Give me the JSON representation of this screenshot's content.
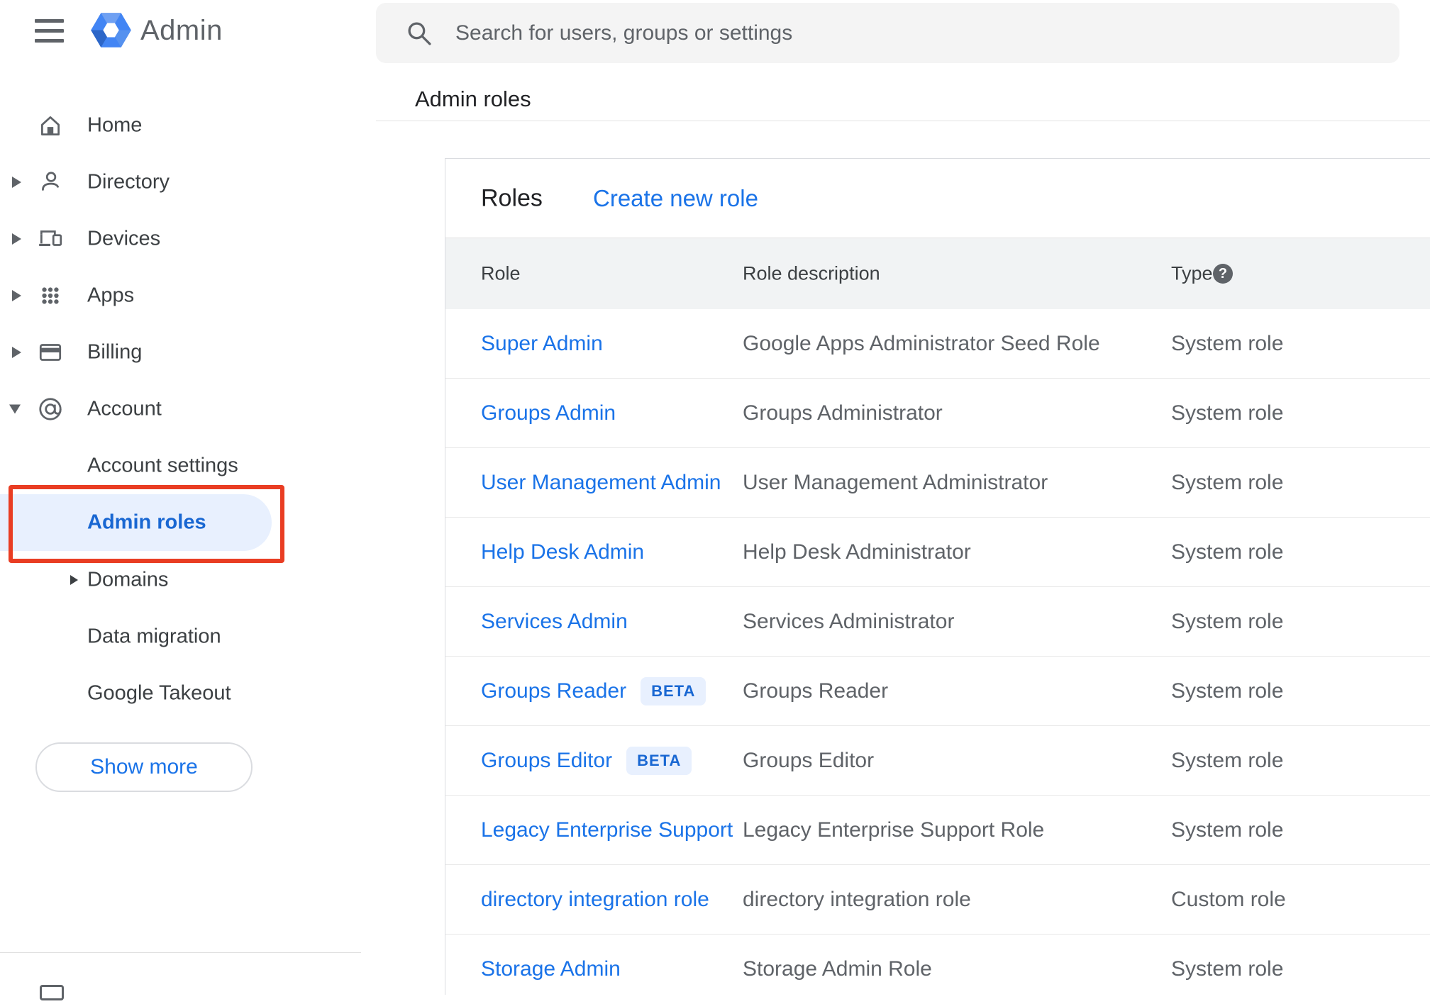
{
  "app_bar": {
    "product_name": "Admin",
    "search_placeholder": "Search for users, groups or settings"
  },
  "sidebar": {
    "items": [
      {
        "label": "Home"
      },
      {
        "label": "Directory"
      },
      {
        "label": "Devices"
      },
      {
        "label": "Apps"
      },
      {
        "label": "Billing"
      },
      {
        "label": "Account"
      },
      {
        "label": "Account settings"
      },
      {
        "label": "Admin roles"
      },
      {
        "label": "Domains"
      },
      {
        "label": "Data migration"
      },
      {
        "label": "Google Takeout"
      }
    ],
    "selected_item": "Admin roles",
    "show_more_label": "Show more"
  },
  "breadcrumb": "Admin roles",
  "content": {
    "card_title": "Roles",
    "create_link": "Create new role",
    "table": {
      "headers": {
        "role": "Role",
        "description": "Role description",
        "type": "Type"
      },
      "rows": [
        {
          "role": "Super Admin",
          "description": "Google Apps Administrator Seed Role",
          "type": "System role"
        },
        {
          "role": "Groups Admin",
          "description": "Groups Administrator",
          "type": "System role"
        },
        {
          "role": "User Management Admin",
          "description": "User Management Administrator",
          "type": "System role"
        },
        {
          "role": "Help Desk Admin",
          "description": "Help Desk Administrator",
          "type": "System role"
        },
        {
          "role": "Services Admin",
          "description": "Services Administrator",
          "type": "System role"
        },
        {
          "role": "Groups Reader",
          "badge": "BETA",
          "description": "Groups Reader",
          "type": "System role"
        },
        {
          "role": "Groups Editor",
          "badge": "BETA",
          "description": "Groups Editor",
          "type": "System role"
        },
        {
          "role": "Legacy Enterprise Support",
          "description": "Legacy Enterprise Support Role",
          "type": "System role"
        },
        {
          "role": "directory integration role",
          "description": "directory integration role",
          "type": "Custom role"
        },
        {
          "role": "Storage Admin",
          "description": "Storage Admin Role",
          "type": "System role"
        }
      ]
    }
  },
  "colors": {
    "link_blue": "#1a73e8",
    "selected_nav_blue": "#1967d2",
    "selected_pill_bg": "#e8f0fe",
    "badge_bg": "#e8f0fe",
    "badge_text": "#1967d2",
    "annotation_red": "#e93d23",
    "table_header_bg": "#f1f3f4",
    "text_dark": "#202124",
    "text_gray": "#5f6368",
    "logo_blue": "#4285f4"
  }
}
